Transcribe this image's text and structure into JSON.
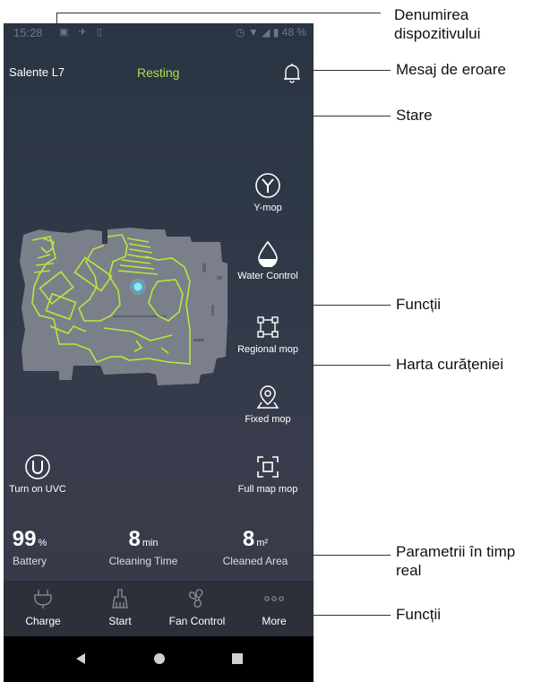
{
  "status_bar": {
    "time": "15:28",
    "battery": "48 %"
  },
  "header": {
    "device_name": "Salente L7",
    "state": "Resting"
  },
  "functions": {
    "ymop": "Y-mop",
    "water_control": "Water Control",
    "regional_mop": "Regional mop",
    "fixed_mop": "Fixed mop",
    "full_map_mop": "Full map mop",
    "uvc": "Turn on UVC"
  },
  "stats": [
    {
      "value": "99",
      "unit": "%",
      "label": "Battery"
    },
    {
      "value": "8",
      "unit": "min",
      "label": "Cleaning Time"
    },
    {
      "value": "8",
      "unit": "m²",
      "label": "Cleaned Area"
    }
  ],
  "bottom_bar": {
    "charge": "Charge",
    "start": "Start",
    "fan_control": "Fan Control",
    "more": "More"
  },
  "annotations": {
    "device_name": [
      "Denumirea",
      "dispozitivului"
    ],
    "error_message": "Mesaj de eroare",
    "state": "Stare",
    "functions_top": "Funcții",
    "map": "Harta curățeniei",
    "realtime": [
      "Parametrii în timp",
      "real"
    ],
    "functions_bottom": "Funcții"
  },
  "colors": {
    "accent": "#a8e052",
    "background": "#2f3746",
    "bottom_bar": "#2d3039"
  }
}
